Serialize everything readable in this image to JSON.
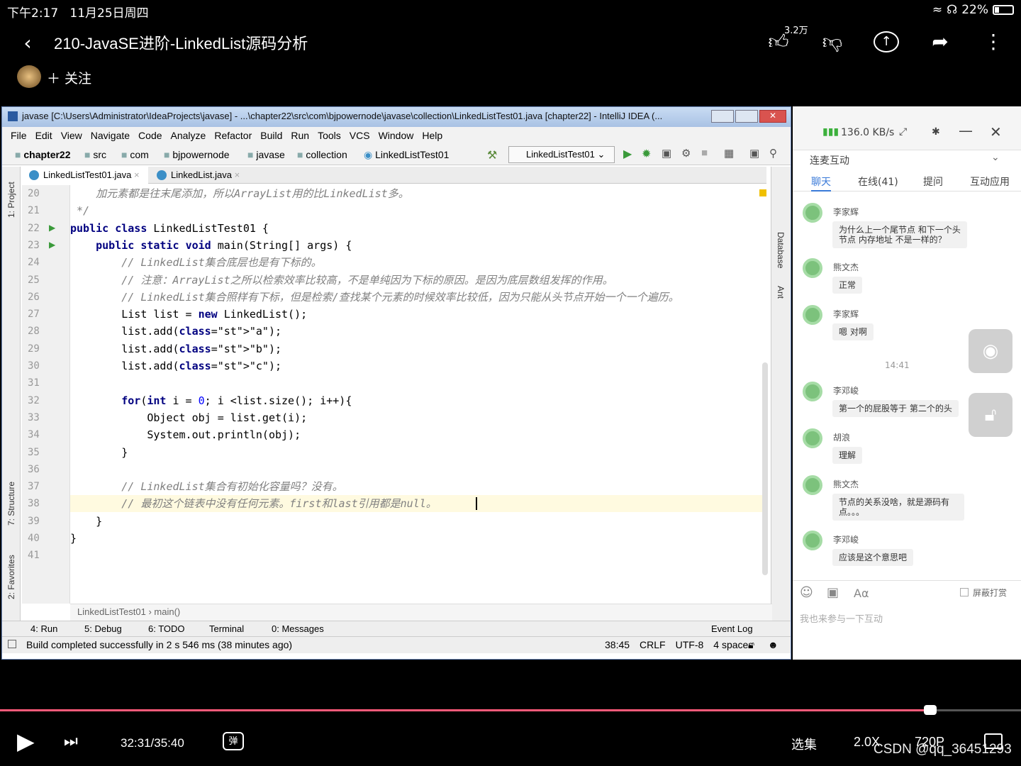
{
  "status_bar": {
    "time": "下午2:17",
    "date": "11月25日周四",
    "battery": "22%"
  },
  "header": {
    "title": "210-JavaSE进阶-LinkedList源码分析",
    "like_count": "3.2万",
    "follow_label": "＋ 关注"
  },
  "ide": {
    "window_title": "javase [C:\\Users\\Administrator\\IdeaProjects\\javase] - ...\\chapter22\\src\\com\\bjpowernode\\javase\\collection\\LinkedListTest01.java [chapter22] - IntelliJ IDEA (...",
    "menu": [
      "File",
      "Edit",
      "View",
      "Navigate",
      "Code",
      "Analyze",
      "Refactor",
      "Build",
      "Run",
      "Tools",
      "VCS",
      "Window",
      "Help"
    ],
    "breadcrumbs": [
      "chapter22",
      "src",
      "com",
      "bjpowernode",
      "javase",
      "collection",
      "LinkedListTest01"
    ],
    "run_config": "LinkedListTest01",
    "tabs": [
      "LinkedListTest01.java",
      "LinkedList.java"
    ],
    "left_tools": [
      "1: Project",
      "7: Structure",
      "2: Favorites"
    ],
    "right_tools": [
      "Database",
      "Ant"
    ],
    "code_breadcrumb": [
      "LinkedListTest01",
      "main()"
    ],
    "tool_windows": [
      "4: Run",
      "5: Debug",
      "6: TODO",
      "Terminal",
      "0: Messages",
      "Event Log"
    ],
    "status_message": "Build completed successfully in 2 s 546 ms (38 minutes ago)",
    "status_right": [
      "38:45",
      "CRLF",
      "UTF-8",
      "4 spaces"
    ]
  },
  "code_lines": [
    {
      "n": "20",
      "t": "    加元素都是往末尾添加，所以ArrayList用的比LinkedList多。"
    },
    {
      "n": "21",
      "t": " */"
    },
    {
      "n": "22",
      "t": "public class LinkedListTest01 {"
    },
    {
      "n": "23",
      "t": "    public static void main(String[] args) {"
    },
    {
      "n": "24",
      "t": "        // LinkedList集合底层也是有下标的。"
    },
    {
      "n": "25",
      "t": "        // 注意：ArrayList之所以检索效率比较高，不是单纯因为下标的原因。是因为底层数组发挥的作用。"
    },
    {
      "n": "26",
      "t": "        // LinkedList集合照样有下标，但是检索/查找某个元素的时候效率比较低，因为只能从头节点开始一个一个遍历。"
    },
    {
      "n": "27",
      "t": "        List list = new LinkedList();"
    },
    {
      "n": "28",
      "t": "        list.add(\"a\");"
    },
    {
      "n": "29",
      "t": "        list.add(\"b\");"
    },
    {
      "n": "30",
      "t": "        list.add(\"c\");"
    },
    {
      "n": "31",
      "t": ""
    },
    {
      "n": "32",
      "t": "        for(int i = 0; i <list.size(); i++){"
    },
    {
      "n": "33",
      "t": "            Object obj = list.get(i);"
    },
    {
      "n": "34",
      "t": "            System.out.println(obj);"
    },
    {
      "n": "35",
      "t": "        }"
    },
    {
      "n": "36",
      "t": ""
    },
    {
      "n": "37",
      "t": "        // LinkedList集合有初始化容量吗？没有。"
    },
    {
      "n": "38",
      "t": "        // 最初这个链表中没有任何元素。first和last引用都是null。"
    },
    {
      "n": "39",
      "t": "    }"
    },
    {
      "n": "40",
      "t": "}"
    },
    {
      "n": "41",
      "t": ""
    }
  ],
  "chat": {
    "speed": "136.0 KB/s",
    "section": "连麦互动",
    "tabs": [
      "聊天",
      "在线(41)",
      "提问",
      "互动应用"
    ],
    "time_marker": "14:41",
    "messages": [
      {
        "name": "李家辉",
        "text": "为什么上一个尾节点 和下一个头节点 内存地址 不是一样的？"
      },
      {
        "name": "熊文杰",
        "text": "正常"
      },
      {
        "name": "李家辉",
        "text": "嗯 对啊"
      },
      {
        "name": "李邓峻",
        "text": "第一个的屁股等于 第二个的头"
      },
      {
        "name": "胡浪",
        "text": "理解"
      },
      {
        "name": "熊文杰",
        "text": "节点的关系没啥，就是源码有点。。。"
      },
      {
        "name": "李邓峻",
        "text": "应该是这个意思吧"
      }
    ],
    "block_label": "屏蔽打赏",
    "input_placeholder": "我也来参与一下互动"
  },
  "player": {
    "time": "32:31/35:40",
    "progress": 0.911,
    "episodes": "选集",
    "speed": "2.0X",
    "quality": "720P",
    "watermark": "CSDN @qq_36451293"
  }
}
